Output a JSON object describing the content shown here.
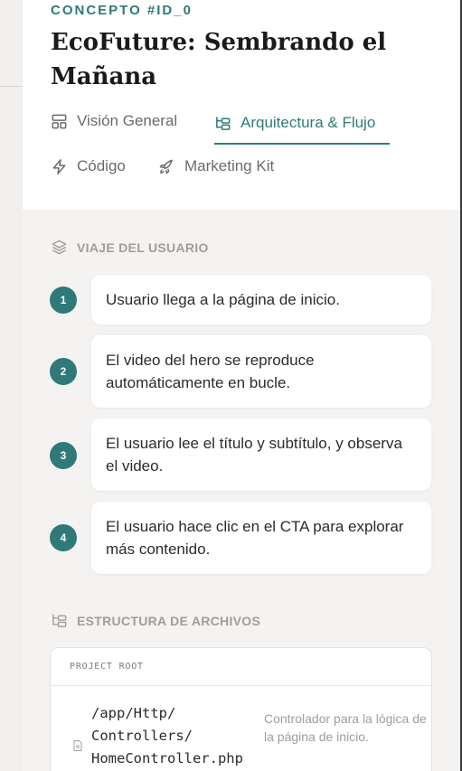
{
  "concept": {
    "id_label": "CONCEPTO #ID_0"
  },
  "page": {
    "title": "EcoFuture: Sembrando el Mañana"
  },
  "tabs": [
    {
      "label": "Visión General",
      "icon": "layout-icon",
      "active": false
    },
    {
      "label": "Arquitectura & Flujo",
      "icon": "folder-tree-icon",
      "active": true
    },
    {
      "label": "Código",
      "icon": "lightning-icon",
      "active": false
    },
    {
      "label": "Marketing Kit",
      "icon": "rocket-icon",
      "active": false
    }
  ],
  "journey": {
    "title": "VIAJE DEL USUARIO",
    "steps": [
      {
        "number": "1",
        "text": "Usuario llega a la página de inicio."
      },
      {
        "number": "2",
        "text": "El video del hero se reproduce automáticamente en bucle."
      },
      {
        "number": "3",
        "text": "El usuario lee el título y subtítulo, y observa el video."
      },
      {
        "number": "4",
        "text": "El usuario hace clic en el CTA para explorar más contenido."
      }
    ]
  },
  "structure": {
    "title": "ESTRUCTURA DE ARCHIVOS",
    "root_label": "PROJECT ROOT",
    "files": [
      {
        "path": "/app/Http/\nControllers/\nHomeController.php",
        "description": "Controlador para la lógica de la página de inicio."
      }
    ]
  },
  "colors": {
    "accent": "#2f7a78",
    "muted": "#a19d98",
    "background": "#f4f3f1"
  }
}
